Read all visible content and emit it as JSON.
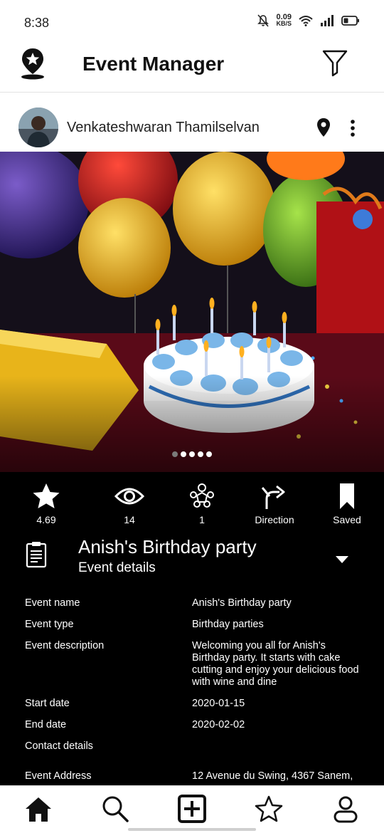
{
  "status_bar": {
    "time": "8:38",
    "net_speed_value": "0.09",
    "net_speed_unit": "KB/S",
    "icons": [
      "mute-icon",
      "wifi-icon",
      "signal-icon",
      "battery-icon"
    ]
  },
  "header": {
    "title": "Event Manager",
    "logo_icon": "location-star-icon",
    "filter_icon": "filter-icon"
  },
  "post": {
    "user_name": "Venkateshwaran Thamilselvan",
    "carousel": {
      "total": 5,
      "active": 1
    }
  },
  "actions": [
    {
      "icon": "star-icon",
      "label": "4.69"
    },
    {
      "icon": "eye-icon",
      "label": "14"
    },
    {
      "icon": "people-group-icon",
      "label": "1"
    },
    {
      "icon": "direction-icon",
      "label": "Direction"
    },
    {
      "icon": "bookmark-icon",
      "label": "Saved"
    }
  ],
  "event": {
    "title": "Anish's Birthday party",
    "subtitle": "Event details",
    "details": [
      {
        "label": "Event name",
        "value": "Anish's Birthday party"
      },
      {
        "label": "Event type",
        "value": "Birthday parties"
      },
      {
        "label": "Event description",
        "value": "Welcoming you all for Anish's Birthday party. It starts with cake cutting and enjoy your delicious food with wine and dine"
      },
      {
        "label": "Start date",
        "value": "2020-01-15"
      },
      {
        "label": "End date",
        "value": "2020-02-02"
      },
      {
        "label": "Contact details",
        "value": ""
      },
      {
        "label": "Event Address",
        "value": "12 Avenue du Swing, 4367 Sanem,"
      }
    ]
  },
  "bottom_nav": [
    {
      "icon": "home-icon",
      "active": true
    },
    {
      "icon": "search-icon",
      "active": false
    },
    {
      "icon": "add-box-icon",
      "active": false
    },
    {
      "icon": "star-outline-icon",
      "active": false
    },
    {
      "icon": "profile-icon",
      "active": false
    }
  ]
}
